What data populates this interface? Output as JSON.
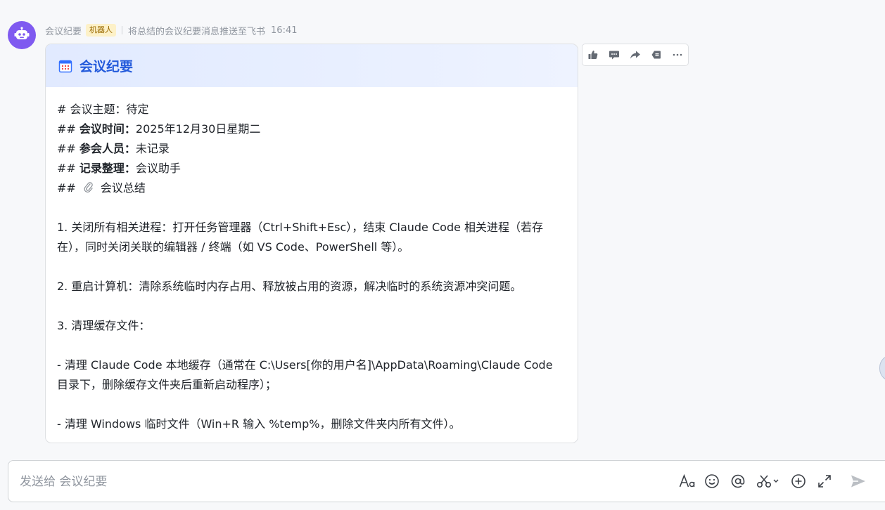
{
  "message": {
    "sender": "会议纪要",
    "badge": "机器人",
    "subtitle": "将总结的会议纪要消息推送至飞书",
    "time": "16:41"
  },
  "card": {
    "title": "会议纪要",
    "lines": {
      "l1": "# 会议主题：待定",
      "l2_prefix": "## ",
      "l2_label": "会议时间：",
      "l2_value": "2025年12月30日星期二",
      "l3_prefix": "## ",
      "l3_label": "参会人员：",
      "l3_value": "未记录",
      "l4_prefix": "## ",
      "l4_label": "记录整理：",
      "l4_value": "会议助手",
      "l5_prefix": "## ",
      "l5_value": "会议总结",
      "p1": "1. 关闭所有相关进程：打开任务管理器（Ctrl+Shift+Esc），结束 Claude Code 相关进程（若存在），同时关闭关联的编辑器 / 终端（如 VS Code、PowerShell 等）。",
      "p2": "2. 重启计算机：清除系统临时内存占用、释放被占用的资源，解决临时的系统资源冲突问题。",
      "p3": "3. 清理缓存文件：",
      "p4": "- 清理 Claude Code 本地缓存（通常在 C:\\Users[你的用户名]\\AppData\\Roaming\\Claude Code 目录下，删除缓存文件夹后重新启动程序）；",
      "p5": "- 清理 Windows 临时文件（Win+R 输入 %temp%，删除文件夹内所有文件）。"
    }
  },
  "composer": {
    "placeholder": "发送给 会议纪要"
  },
  "icons": {
    "avatar": "robot-icon",
    "card_header": "calendar-icon",
    "summary": "paperclip-icon",
    "actions": [
      "thumbs-up-icon",
      "comment-icon",
      "forward-icon",
      "pin-icon",
      "more-icon"
    ],
    "toolbar": [
      "text-format-icon",
      "emoji-icon",
      "mention-icon",
      "screenshot-icon",
      "add-icon",
      "expand-icon",
      "send-icon"
    ]
  },
  "colors": {
    "accent": "#245bdb",
    "avatar": "#7f5af0",
    "badge_bg": "#fdf1c8"
  }
}
